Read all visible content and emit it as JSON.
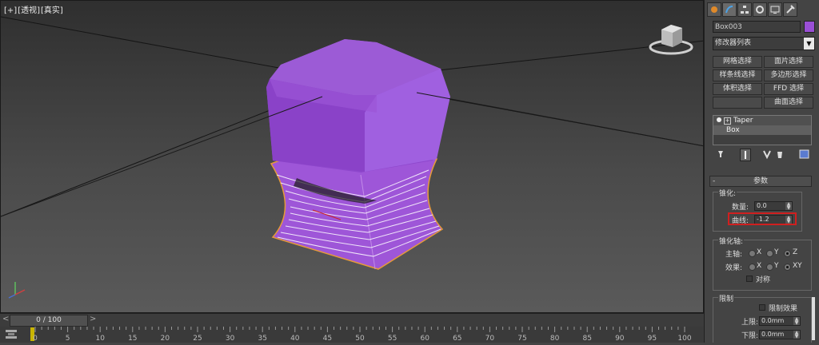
{
  "viewport": {
    "label_parts": [
      "[+]",
      "[透视]",
      "[真实]"
    ],
    "colors": {
      "object": "#9a4fd6",
      "selection_edge": "#e69a3a"
    }
  },
  "time_slider": {
    "left_arrow": "<",
    "position": "0 / 100",
    "right_arrow": ">"
  },
  "track_bar": {
    "tick_labels": [
      "0",
      "5",
      "10",
      "15",
      "20",
      "25",
      "30",
      "35",
      "40",
      "45",
      "50",
      "55",
      "60",
      "65",
      "70",
      "75",
      "80",
      "85",
      "90",
      "95",
      "100"
    ]
  },
  "panel": {
    "tabs": [
      "create-icon",
      "modify-icon",
      "hierarchy-icon",
      "motion-icon",
      "display-icon",
      "utilities-icon"
    ],
    "object_name": "Box003",
    "object_color": "#9a4fd6",
    "modifier_list": "修改器列表",
    "selection_buttons": [
      "网格选择",
      "面片选择",
      "样条线选择",
      "多边形选择",
      "体积选择",
      "FFD 选择",
      "",
      "曲面选择"
    ],
    "stack": {
      "top_item": "Taper",
      "selected_item": "Box"
    },
    "rollout_title": "参数",
    "taper_group": {
      "title": "锥化:",
      "amount_label": "数量:",
      "amount_value": "0.0",
      "curve_label": "曲线:",
      "curve_value": "-1.2"
    },
    "axis_group": {
      "title": "锥化轴:",
      "primary_label": "主轴:",
      "primary_options": [
        "X",
        "Y",
        "Z"
      ],
      "primary_selected": "Z",
      "effect_label": "效果:",
      "effect_options": [
        "X",
        "Y",
        "XY"
      ],
      "effect_selected": "XY",
      "symmetry_label": "对称"
    },
    "limits_group": {
      "title": "限制",
      "limit_effect_label": "限制效果",
      "upper_label": "上限:",
      "upper_value": "0.0mm",
      "lower_label": "下限:",
      "lower_value": "0.0mm"
    }
  }
}
